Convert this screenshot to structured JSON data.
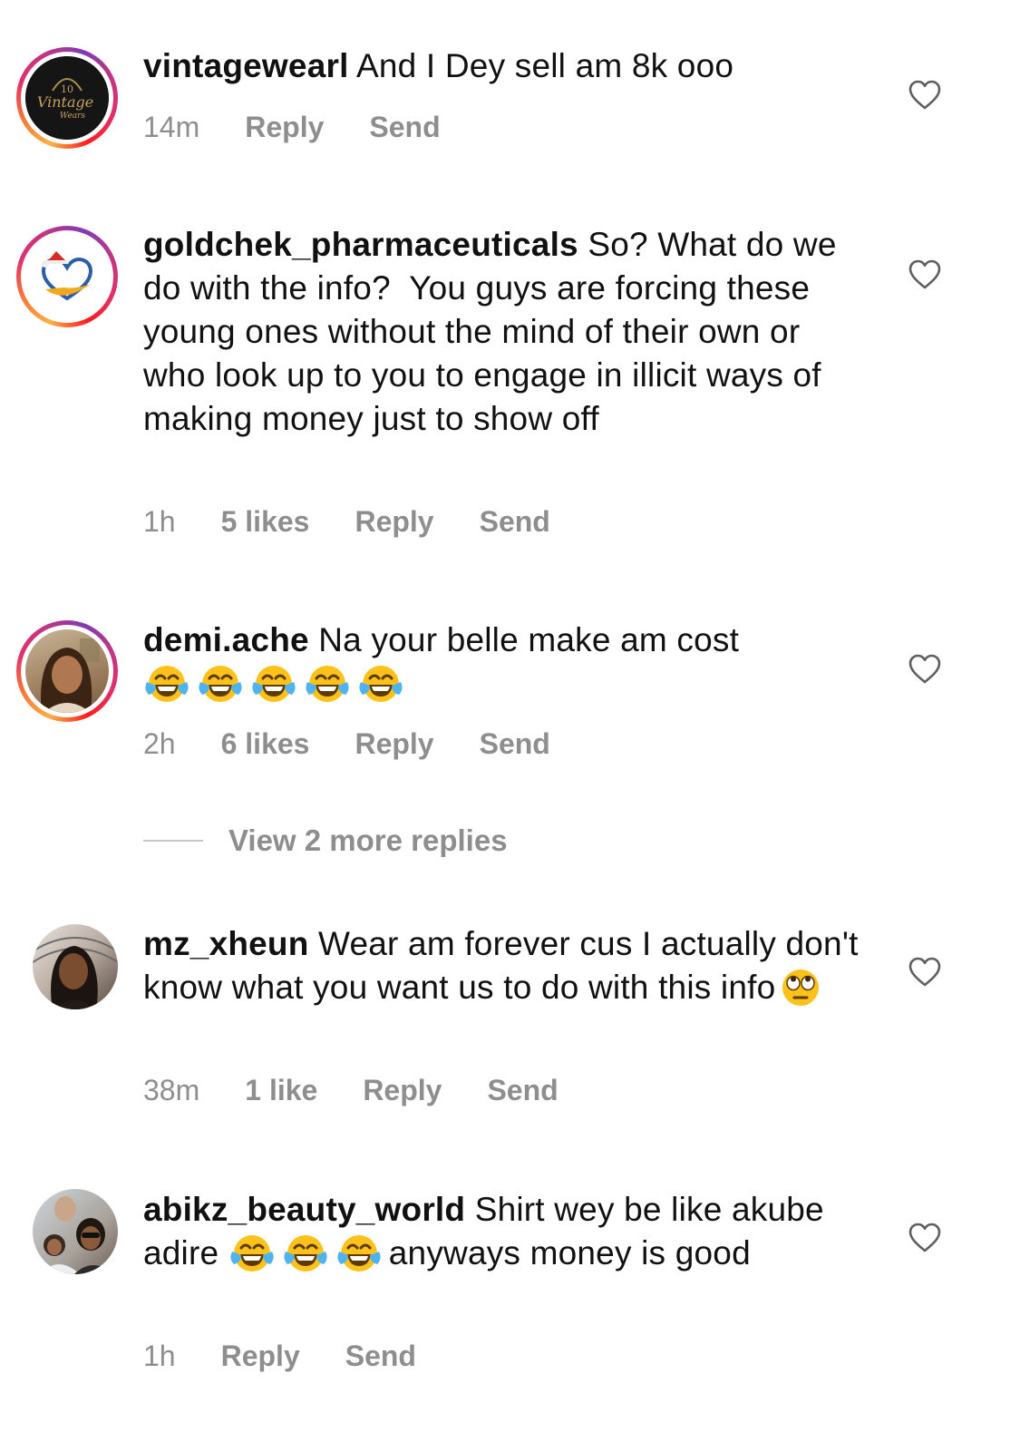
{
  "comments": [
    {
      "username": "vintagewearl",
      "text": "And I Dey sell am 8k ooo",
      "time": "14m",
      "likes": "",
      "reply": "Reply",
      "send": "Send"
    },
    {
      "username": "goldchek_pharmaceuticals",
      "text": "So? What do we do with the info?  You guys are forcing these young ones without the mind of their own or who look up to you to engage in illicit ways of making money just to show off",
      "time": "1h",
      "likes": "5 likes",
      "reply": "Reply",
      "send": "Send"
    },
    {
      "username": "demi.ache",
      "text": "Na your belle make am cost",
      "emoji": "face-with-tears-of-joy",
      "emoji_count": 5,
      "time": "2h",
      "likes": "6 likes",
      "reply": "Reply",
      "send": "Send"
    },
    {
      "username": "mz_xheun",
      "text": "Wear am forever cus I actually don't know what you want us to do with this info",
      "emoji": "face-with-rolling-eyes",
      "time": "38m",
      "likes": "1 like",
      "reply": "Reply",
      "send": "Send"
    },
    {
      "username": "abikz_beauty_world",
      "text_before": "Shirt wey be like akube adire ",
      "emoji": "face-with-tears-of-joy",
      "emoji_count": 3,
      "text_after": "anyways money is good",
      "time": "1h",
      "likes": "",
      "reply": "Reply",
      "send": "Send"
    }
  ],
  "view_more": "View 2 more replies",
  "avatar_logo_text": [
    "10",
    "Vintage",
    "Wears"
  ],
  "colors": {
    "text": "#111111",
    "secondary": "#8e8e8e",
    "story_ring": [
      "#fcaf45",
      "#f77737",
      "#e1306c",
      "#c13584",
      "#833ab4"
    ]
  },
  "icons": [
    "heart-outline-icon",
    "face-with-tears-of-joy",
    "face-with-rolling-eyes"
  ]
}
